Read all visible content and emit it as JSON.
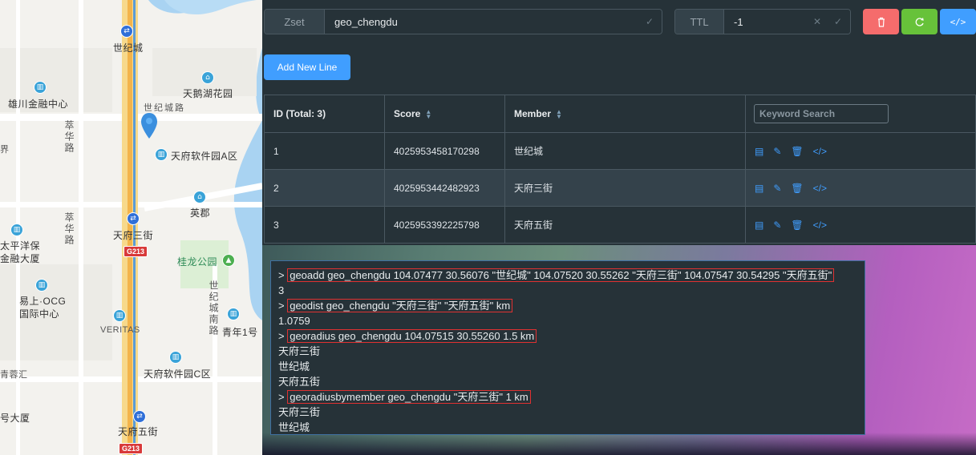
{
  "map": {
    "labels": {
      "shijicheng_top": "世纪城",
      "xiongchuan": "雄川金融中心",
      "tiane": "天鹅湖花园",
      "shijicheng_road": "世纪城路",
      "jing": "界",
      "tianfu_soft_a": "天府软件园A区",
      "yingjun": "英郡",
      "tianfu3": "天府三街",
      "taipingyang": "太平洋保",
      "jinrong": "金融大厦",
      "guilong": "桂龙公园",
      "yishang": "易上·OCG",
      "guoji": "国际中心",
      "veritas": "VERITAS",
      "tianfu_soft_c": "天府软件园C区",
      "qingnian": "青年1号",
      "qingrong": "青蓉汇",
      "hao_dasha": "号大厦",
      "tianfu5": "天府五街",
      "cuihua1": "萃华路",
      "cuihua2": "萃华路",
      "shiji_nanlu": "世纪城南路"
    },
    "road_badges": [
      "G213",
      "G213"
    ],
    "pin_color": "#3b8fde"
  },
  "toolbar": {
    "type_label": "Zset",
    "key_value": "geo_chengdu",
    "ttl_label": "TTL",
    "ttl_value": "-1",
    "delete_color": "#f56c6c",
    "refresh_color": "#67c23a",
    "code_color": "#409eff"
  },
  "add_line_label": "Add New Line",
  "table": {
    "headers": {
      "id": "ID (Total: 3)",
      "score": "Score",
      "member": "Member"
    },
    "search_placeholder": "Keyword Search",
    "rows": [
      {
        "id": "1",
        "score": "4025953458170298",
        "member": "世纪城"
      },
      {
        "id": "2",
        "score": "4025953442482923",
        "member": "天府三街"
      },
      {
        "id": "3",
        "score": "4025953392225798",
        "member": "天府五街"
      }
    ]
  },
  "console": {
    "prompt": ">",
    "lines": [
      {
        "kind": "cmd",
        "text": "geoadd geo_chengdu 104.07477 30.56076 \"世纪城\" 104.07520 30.55262 \"天府三街\" 104.07547 30.54295 \"天府五街\""
      },
      {
        "kind": "out",
        "text": "3"
      },
      {
        "kind": "cmd",
        "text": "geodist geo_chengdu \"天府三街\" \"天府五街\" km"
      },
      {
        "kind": "out",
        "text": "1.0759"
      },
      {
        "kind": "cmd",
        "text": "georadius geo_chengdu 104.07515 30.55260 1.5 km"
      },
      {
        "kind": "out",
        "text": "天府三街"
      },
      {
        "kind": "out",
        "text": "世纪城"
      },
      {
        "kind": "out",
        "text": "天府五街"
      },
      {
        "kind": "cmd",
        "text": "georadiusbymember geo_chengdu \"天府三街\" 1 km"
      },
      {
        "kind": "out",
        "text": "天府三街"
      },
      {
        "kind": "out",
        "text": "世纪城"
      }
    ]
  }
}
